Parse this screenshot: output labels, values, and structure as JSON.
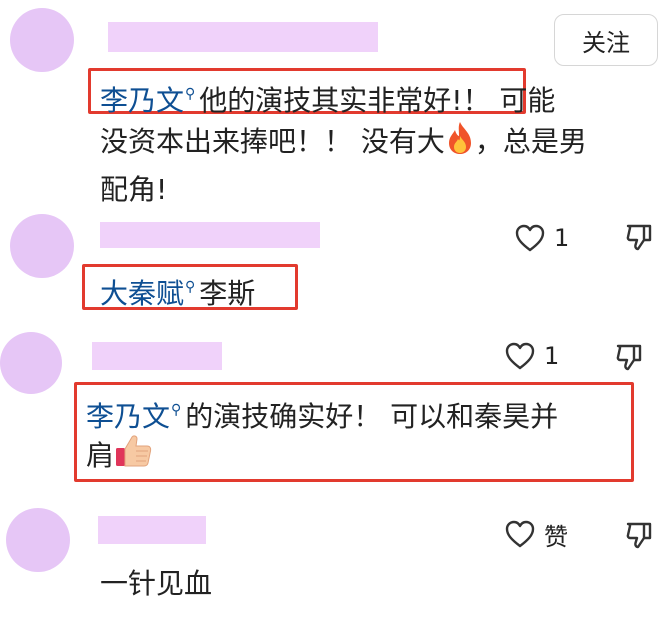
{
  "follow_label": "关注",
  "comments": [
    {
      "mention": "李乃文",
      "text_line1_a": "他的演技其实非常好!",
      "text_line1_b": "！ 可能",
      "text_line2": "没资本出来捧吧！！ 没有大",
      "text_line2_after": "，总是男",
      "text_line3": "配角!"
    },
    {
      "mention": "大秦赋",
      "text": "李斯",
      "like_count": "1"
    },
    {
      "mention": "李乃文",
      "text_line1": "的演技确实好！ 可以和秦昊并",
      "text_line2": "肩",
      "like_count": "1"
    },
    {
      "text": "一针见血",
      "like_label": "赞"
    }
  ],
  "icons": {
    "search": "magnifier-icon",
    "fire": "fire-icon",
    "thumbs_up": "thumbs-up-icon",
    "like": "heart-icon",
    "dislike": "thumbs-down-icon"
  },
  "colors": {
    "mention": "#0e4f93",
    "highlight_box": "#e23a2e",
    "avatar": "#e6c6f6"
  }
}
